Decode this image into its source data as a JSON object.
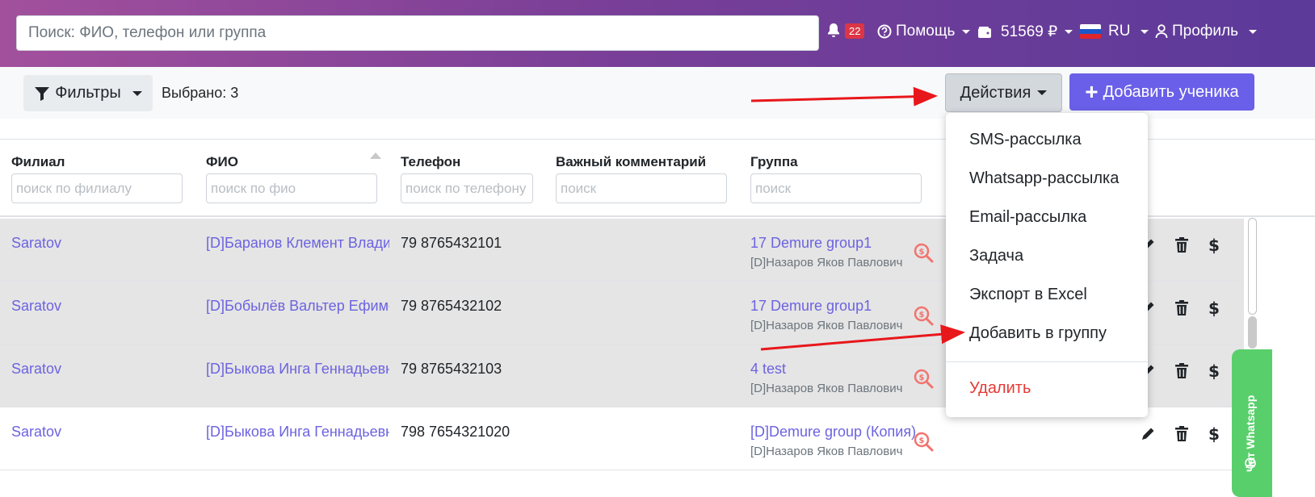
{
  "header": {
    "search_placeholder": "Поиск: ФИО, телефон или группа",
    "notifications_count": "22",
    "help_label": "Помощь",
    "balance_label": "51569 ₽",
    "language_label": "RU",
    "profile_label": "Профиль"
  },
  "toolbar": {
    "filters_label": "Фильтры",
    "selected_label": "Выбрано: 3",
    "actions_label": "Действия",
    "add_student_label": "Добавить ученика"
  },
  "table": {
    "columns": [
      {
        "label": "Филиал",
        "placeholder": "поиск по филиалу"
      },
      {
        "label": "ФИО",
        "placeholder": "поиск по фио"
      },
      {
        "label": "Телефон",
        "placeholder": "поиск по телефону"
      },
      {
        "label": "Важный комментарий",
        "placeholder": "поиск"
      },
      {
        "label": "Группа",
        "placeholder": "поиск"
      }
    ],
    "rows": [
      {
        "branch": "Saratov",
        "name": "[D]Баранов Клемент Владимирович",
        "phone": "79 8765432101",
        "group": "17 Demure group1",
        "teacher": "[D]Назаров Яков Павлович",
        "selected": true
      },
      {
        "branch": "Saratov",
        "name": "[D]Бобылёв Вальтер Ефимович",
        "phone": "79 8765432102",
        "group": "17 Demure group1",
        "teacher": "[D]Назаров Яков Павлович",
        "selected": true
      },
      {
        "branch": "Saratov",
        "name": "[D]Быкова Инга Геннадьевна",
        "phone": "79 8765432103",
        "group": "4 test",
        "teacher": "[D]Назаров Яков Павлович",
        "selected": true
      },
      {
        "branch": "Saratov",
        "name": "[D]Быкова Инга Геннадьевна",
        "phone": "798 7654321020",
        "group": "[D]Demure group (Копия)",
        "teacher": "[D]Назаров Яков Павлович",
        "selected": false
      }
    ]
  },
  "actions_menu": {
    "items": [
      "SMS-рассылка",
      "Whatsapp-рассылка",
      "Email-рассылка",
      "Задача",
      "Экспорт в Excel",
      "Добавить в группу"
    ],
    "delete_label": "Удалить"
  },
  "whatsapp_chat": {
    "label": "Чат Whatsapp"
  },
  "colors": {
    "header_gradient_start": "#a2509c",
    "header_gradient_end": "#5b3a9a",
    "primary": "#6a5fe8",
    "link": "#6c63e0",
    "danger": "#e53935",
    "whatsapp": "#59cf6b"
  },
  "icons": [
    "bell-icon",
    "help-icon",
    "wallet-icon",
    "ru-flag-icon",
    "user-icon",
    "filter-icon",
    "plus-icon",
    "money-search-icon",
    "pencil-icon",
    "trash-icon",
    "dollar-icon",
    "whatsapp-icon"
  ]
}
